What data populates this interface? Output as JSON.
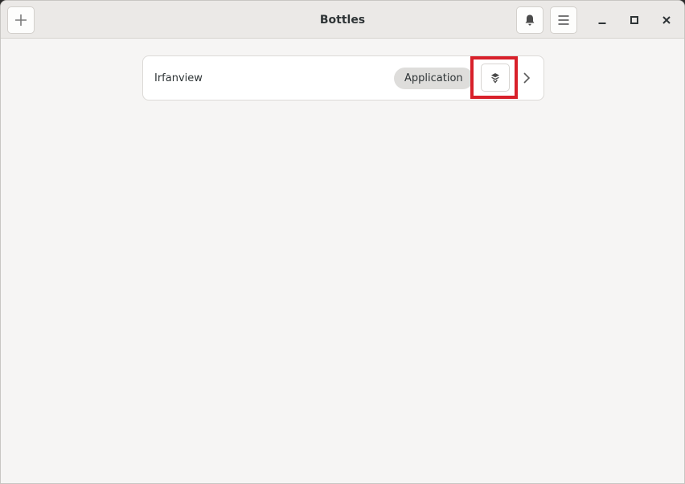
{
  "window": {
    "title": "Bottles"
  },
  "headerbar": {
    "add_icon": "plus-icon",
    "notifications_icon": "bell-icon",
    "menu_icon": "hamburger-menu-icon",
    "minimize_icon": "minimize-icon",
    "maximize_icon": "maximize-icon",
    "close_icon": "close-icon"
  },
  "bottle_list": {
    "items": [
      {
        "name": "Irfanview",
        "environment": "Application",
        "run_icon": "layers-run-icon",
        "details_icon": "chevron-right-icon"
      }
    ]
  },
  "colors": {
    "highlight": "#d8202a",
    "headerbar_bg": "#ebe9e7",
    "window_bg": "#f6f5f4"
  }
}
